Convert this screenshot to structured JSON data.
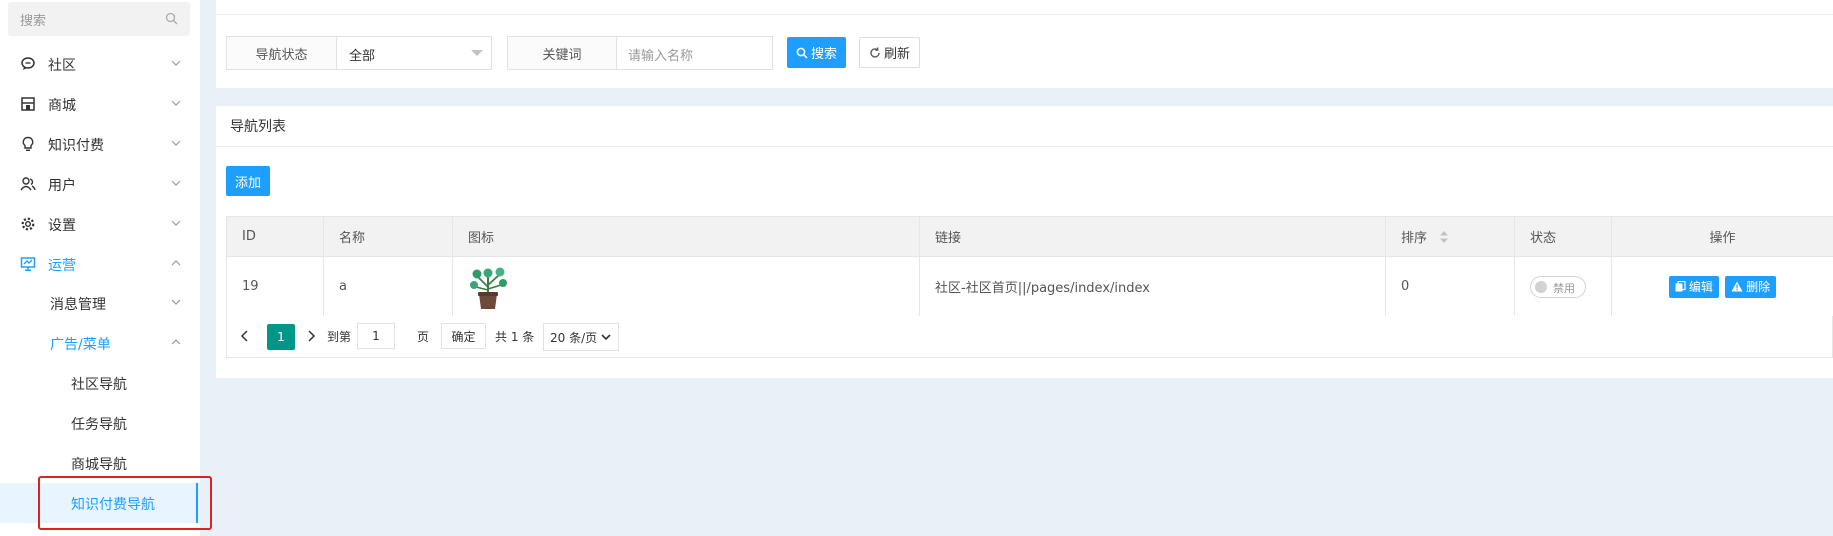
{
  "sidebar": {
    "search_placeholder": "搜索",
    "items": [
      {
        "label": "社区",
        "icon": "chat-bubble-icon"
      },
      {
        "label": "商城",
        "icon": "store-icon"
      },
      {
        "label": "知识付费",
        "icon": "lightbulb-icon"
      },
      {
        "label": "用户",
        "icon": "users-icon"
      },
      {
        "label": "设置",
        "icon": "gear-icon"
      },
      {
        "label": "运营",
        "icon": "dashboard-icon"
      }
    ],
    "sub_items": [
      "消息管理",
      "广告/菜单"
    ],
    "leaf_items": [
      "社区导航",
      "任务导航",
      "商城导航",
      "知识付费导航"
    ],
    "accent": "#1e9fff"
  },
  "filters": {
    "nav_status_label": "导航状态",
    "nav_status_value": "全部",
    "keyword_label": "关键词",
    "keyword_placeholder": "请输入名称",
    "search_button": "搜索",
    "refresh_button": "刷新"
  },
  "list": {
    "title": "导航列表",
    "add_button": "添加",
    "columns": [
      "ID",
      "名称",
      "图标",
      "链接",
      "排序",
      "状态",
      "操作"
    ],
    "rows": [
      {
        "id": "19",
        "name": "a",
        "icon": "potted-plant-icon",
        "link": "社区-社区首页||/pages/index/index",
        "sort": "0",
        "status": "禁用",
        "edit": "编辑",
        "delete": "删除"
      }
    ]
  },
  "pagination": {
    "current": "1",
    "goto_prefix": "到第",
    "goto_value": "1",
    "goto_suffix": "页",
    "confirm": "确定",
    "total": "共 1 条",
    "page_size": "20 条/页"
  }
}
